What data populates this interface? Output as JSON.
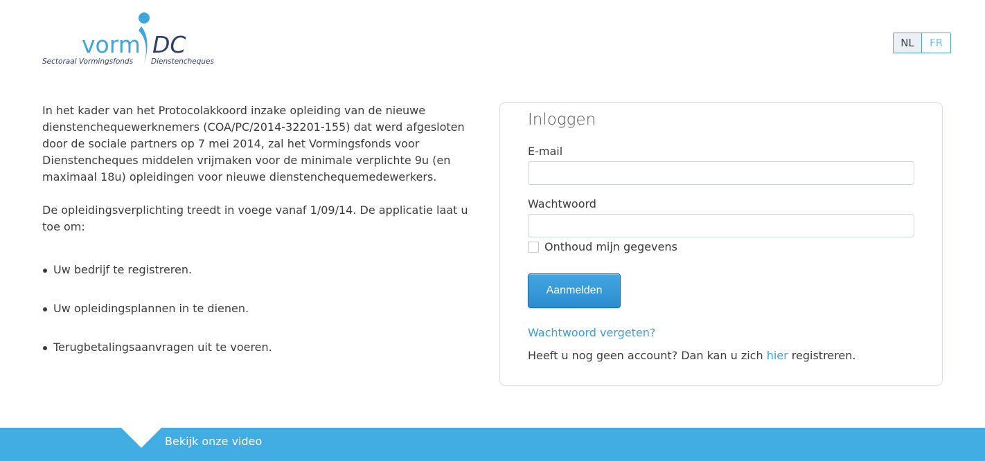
{
  "logo": {
    "word_vorm": "vorm",
    "word_dc": "DC",
    "tagline_left": "Sectoraal Vormingsfonds",
    "tagline_right": "Dienstencheques",
    "brand_color": "#3ea6dc",
    "dark_color": "#2f3f6c"
  },
  "language": {
    "options": [
      "NL",
      "FR"
    ],
    "selected": "NL"
  },
  "intro": {
    "paragraph1": "In het kader van het Protocolakkoord inzake opleiding van de nieuwe dienstenchequewerknemers (COA/PC/2014-32201-155) dat werd afgesloten door de sociale partners op 7 mei 2014, zal het Vormingsfonds voor Dienstencheques middelen vrijmaken voor de minimale verplichte 9u (en maximaal 18u) opleidingen voor nieuwe dienstenchequemedewerkers.",
    "paragraph2": "De opleidingsverplichting treedt in voege vanaf 1/09/14. De applicatie laat u toe om:",
    "items": [
      "Uw bedrijf te registreren.",
      "Uw opleidingsplannen in te dienen.",
      "Terugbetalingsaanvragen uit te voeren."
    ]
  },
  "login": {
    "title": "Inloggen",
    "email_label": "E-mail",
    "email_value": "",
    "password_label": "Wachtwoord",
    "password_value": "",
    "remember_label": "Onthoud mijn gegevens",
    "submit_label": "Aanmelden",
    "forgot_label": "Wachtwoord vergeten?",
    "register_prefix": "Heeft u nog geen account? Dan kan u zich",
    "register_link": "hier",
    "register_suffix": "registreren."
  },
  "footer": {
    "video_label": "Bekijk onze video"
  },
  "colors": {
    "accent": "#42ade3",
    "link": "#3aa0d8",
    "button": "#2b8dcf"
  }
}
